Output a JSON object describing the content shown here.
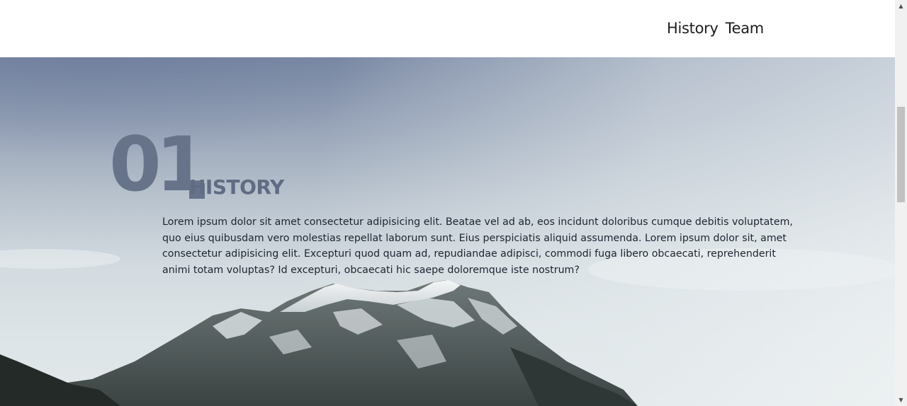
{
  "nav": {
    "items": [
      {
        "label": "History"
      },
      {
        "label": "Team"
      }
    ]
  },
  "section": {
    "number": "01",
    "title": "HISTORY",
    "body": "Lorem ipsum dolor sit amet consectetur adipisicing elit. Beatae vel ad ab, eos incidunt doloribus cumque debitis voluptatem, quo eius quibusdam vero molestias repellat laborum sunt. Eius perspiciatis aliquid assumenda. Lorem ipsum dolor sit, amet consectetur adipisicing elit. Excepturi quod quam ad, repudiandae adipisci, commodi fuga libero obcaecati, reprehenderit animi totam voluptas? Id excepturi, obcaecati hic saepe doloremque iste nostrum?"
  },
  "colors": {
    "header_bg": "#ffffff",
    "nav_text": "#1e1e1e",
    "section_accent": "#667389",
    "body_text": "#1e2430"
  },
  "icons": {
    "scroll_up": "triangle-up-icon",
    "scroll_down": "triangle-down-icon"
  }
}
